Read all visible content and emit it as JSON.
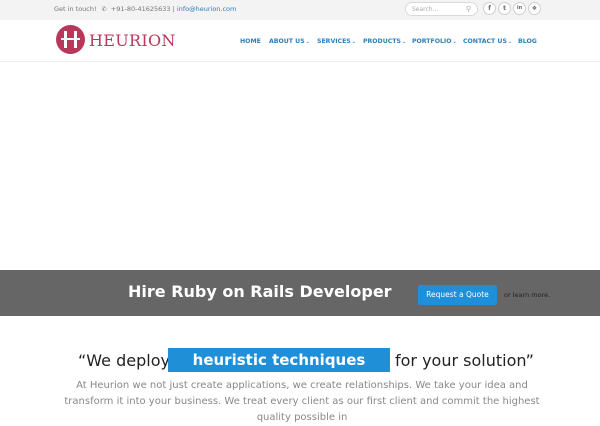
{
  "topbar": {
    "get_in_touch": "Get in touch!",
    "phone": "+91-80-41625633",
    "separator": "|",
    "email": "info@heurion.com",
    "search_placeholder": "Search...",
    "social": [
      "f",
      "t",
      "in",
      "❖"
    ]
  },
  "header": {
    "logo_text": "HEURION",
    "nav": [
      {
        "label": "HOME",
        "dropdown": false
      },
      {
        "label": "ABOUT US",
        "dropdown": true
      },
      {
        "label": "SERVICES",
        "dropdown": true
      },
      {
        "label": "PRODUCTS",
        "dropdown": true
      },
      {
        "label": "PORTFOLIO",
        "dropdown": true
      },
      {
        "label": "CONTACT US",
        "dropdown": true
      },
      {
        "label": "BLOG",
        "dropdown": false
      }
    ]
  },
  "cta": {
    "title": "Hire Ruby on Rails Developer",
    "button": "Request a Quote",
    "or": "or",
    "learn_more": "learn more."
  },
  "quote": {
    "open": "“We deploy",
    "highlight": "heuristic techniques",
    "close": "for your solution”"
  },
  "intro": "At Heurion we not just create applications, we create relationships. We take your idea and transform it into your business. We treat every client as our first client and commit the highest quality possible in",
  "colors": {
    "brand": "#b8385a",
    "accent": "#1f8fd8",
    "nav": "#2b7fb9",
    "band": "#666666"
  }
}
